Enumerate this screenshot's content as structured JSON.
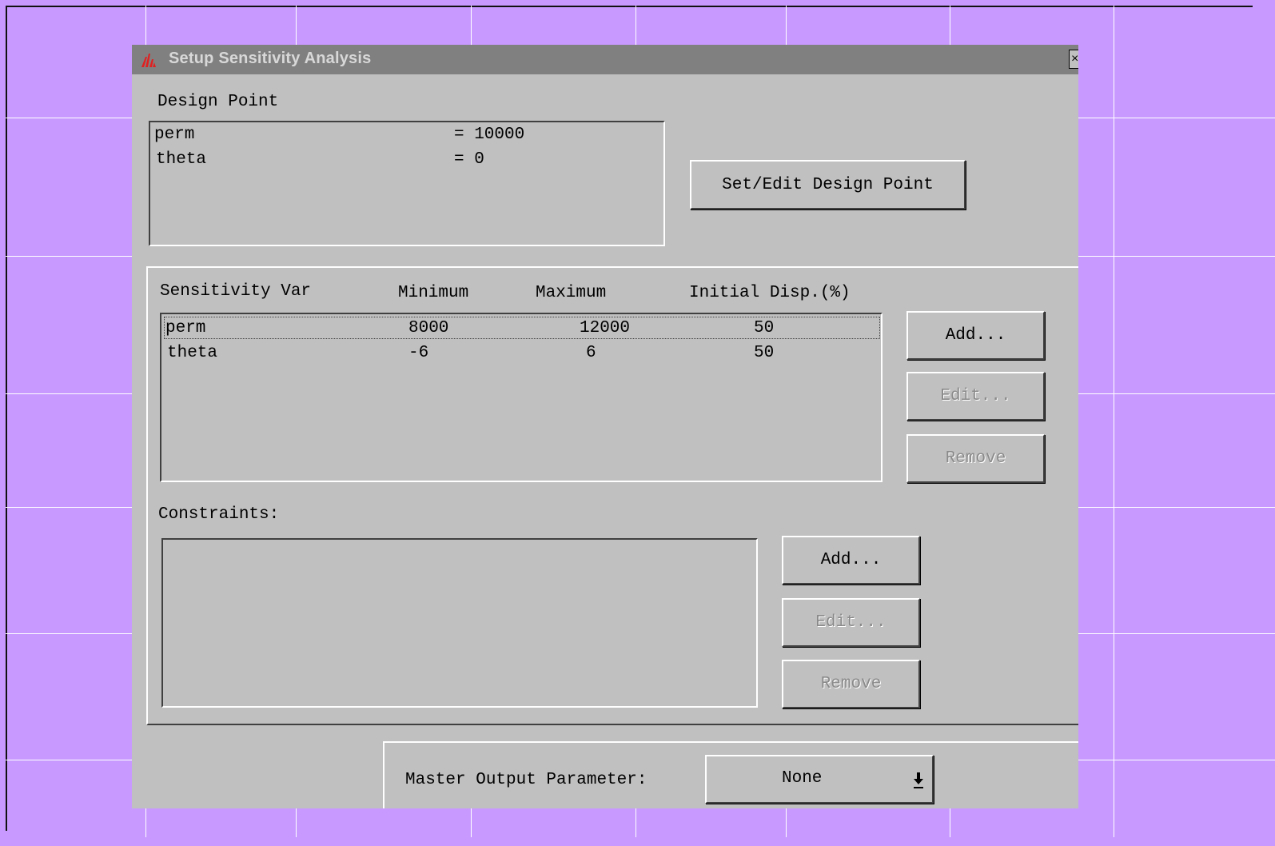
{
  "window": {
    "title": "Setup Sensitivity Analysis",
    "close_label": "×"
  },
  "design_point": {
    "label": "Design Point",
    "rows": [
      {
        "name": "perm",
        "value": "= 10000"
      },
      {
        "name": "theta",
        "value": "= 0"
      }
    ],
    "set_edit_button": "Set/Edit Design Point"
  },
  "sensitivity": {
    "headers": [
      "Sensitivity Var",
      "Minimum",
      "Maximum",
      "Initial Disp.(%)"
    ],
    "rows": [
      [
        "perm",
        "8000",
        "12000",
        "50"
      ],
      [
        "theta",
        "-6",
        "6",
        "50"
      ]
    ],
    "add_button": "Add...",
    "edit_button": "Edit...",
    "remove_button": "Remove"
  },
  "constraints": {
    "label": "Constraints:",
    "add_button": "Add...",
    "edit_button": "Edit...",
    "remove_button": "Remove"
  },
  "master_output": {
    "label": "Master Output Parameter:",
    "selected": "None"
  }
}
